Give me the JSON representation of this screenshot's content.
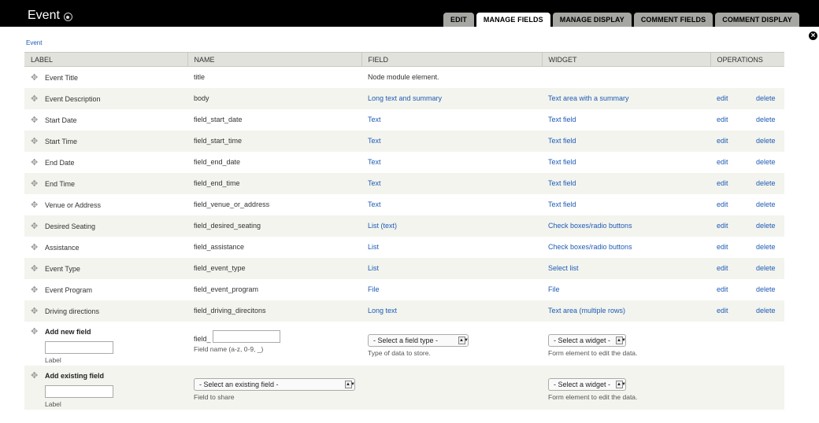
{
  "header": {
    "title": "Event",
    "tabs": [
      {
        "label": "EDIT",
        "active": false
      },
      {
        "label": "MANAGE FIELDS",
        "active": true
      },
      {
        "label": "MANAGE DISPLAY",
        "active": false
      },
      {
        "label": "COMMENT FIELDS",
        "active": false
      },
      {
        "label": "COMMENT DISPLAY",
        "active": false
      }
    ]
  },
  "breadcrumb": "Event",
  "table": {
    "headers": [
      "LABEL",
      "NAME",
      "FIELD",
      "WIDGET",
      "OPERATIONS"
    ],
    "rows": [
      {
        "label": "Event Title",
        "name": "title",
        "field": "Node module element.",
        "widget": "",
        "edit": "",
        "delete": ""
      },
      {
        "label": "Event Description",
        "name": "body",
        "field": "Long text and summary",
        "widget": "Text area with a summary",
        "edit": "edit",
        "delete": "delete"
      },
      {
        "label": "Start Date",
        "name": "field_start_date",
        "field": "Text",
        "widget": "Text field",
        "edit": "edit",
        "delete": "delete"
      },
      {
        "label": "Start Time",
        "name": "field_start_time",
        "field": "Text",
        "widget": "Text field",
        "edit": "edit",
        "delete": "delete"
      },
      {
        "label": "End Date",
        "name": "field_end_date",
        "field": "Text",
        "widget": "Text field",
        "edit": "edit",
        "delete": "delete"
      },
      {
        "label": "End Time",
        "name": "field_end_time",
        "field": "Text",
        "widget": "Text field",
        "edit": "edit",
        "delete": "delete"
      },
      {
        "label": "Venue or Address",
        "name": "field_venue_or_address",
        "field": "Text",
        "widget": "Text field",
        "edit": "edit",
        "delete": "delete"
      },
      {
        "label": "Desired Seating",
        "name": "field_desired_seating",
        "field": "List (text)",
        "widget": "Check boxes/radio buttons",
        "edit": "edit",
        "delete": "delete"
      },
      {
        "label": "Assistance",
        "name": "field_assistance",
        "field": "List",
        "widget": "Check boxes/radio buttons",
        "edit": "edit",
        "delete": "delete"
      },
      {
        "label": "Event Type",
        "name": "field_event_type",
        "field": "List",
        "widget": "Select list",
        "edit": "edit",
        "delete": "delete"
      },
      {
        "label": "Event Program",
        "name": "field_event_program",
        "field": "File",
        "widget": "File",
        "edit": "edit",
        "delete": "delete"
      },
      {
        "label": "Driving directions",
        "name": "field_driving_direcitons",
        "field": "Long text",
        "widget": "Text area (multiple rows)",
        "edit": "edit",
        "delete": "delete"
      }
    ]
  },
  "add_new": {
    "title": "Add new field",
    "label_value": "",
    "label_hint": "Label",
    "name_prefix": "field_",
    "name_value": "",
    "name_hint": "Field name (a-z, 0-9, _)",
    "type_select": "- Select a field type -",
    "type_hint": "Type of data to store.",
    "widget_select": "- Select a widget -",
    "widget_hint": "Form element to edit the data."
  },
  "add_existing": {
    "title": "Add existing field",
    "label_value": "",
    "label_hint": "Label",
    "field_select": "- Select an existing field -",
    "field_hint": "Field to share",
    "widget_select": "- Select a widget -",
    "widget_hint": "Form element to edit the data."
  },
  "icons": {
    "drag": "drag-handle-icon",
    "close": "close-icon",
    "title": "circle-dot-icon"
  },
  "colors": {
    "link": "#1e5bb5",
    "header_bg": "#000000",
    "tab_bg": "#a6a7a2",
    "table_header_bg": "#e1e2dc",
    "row_even_bg": "#f3f4ee"
  }
}
